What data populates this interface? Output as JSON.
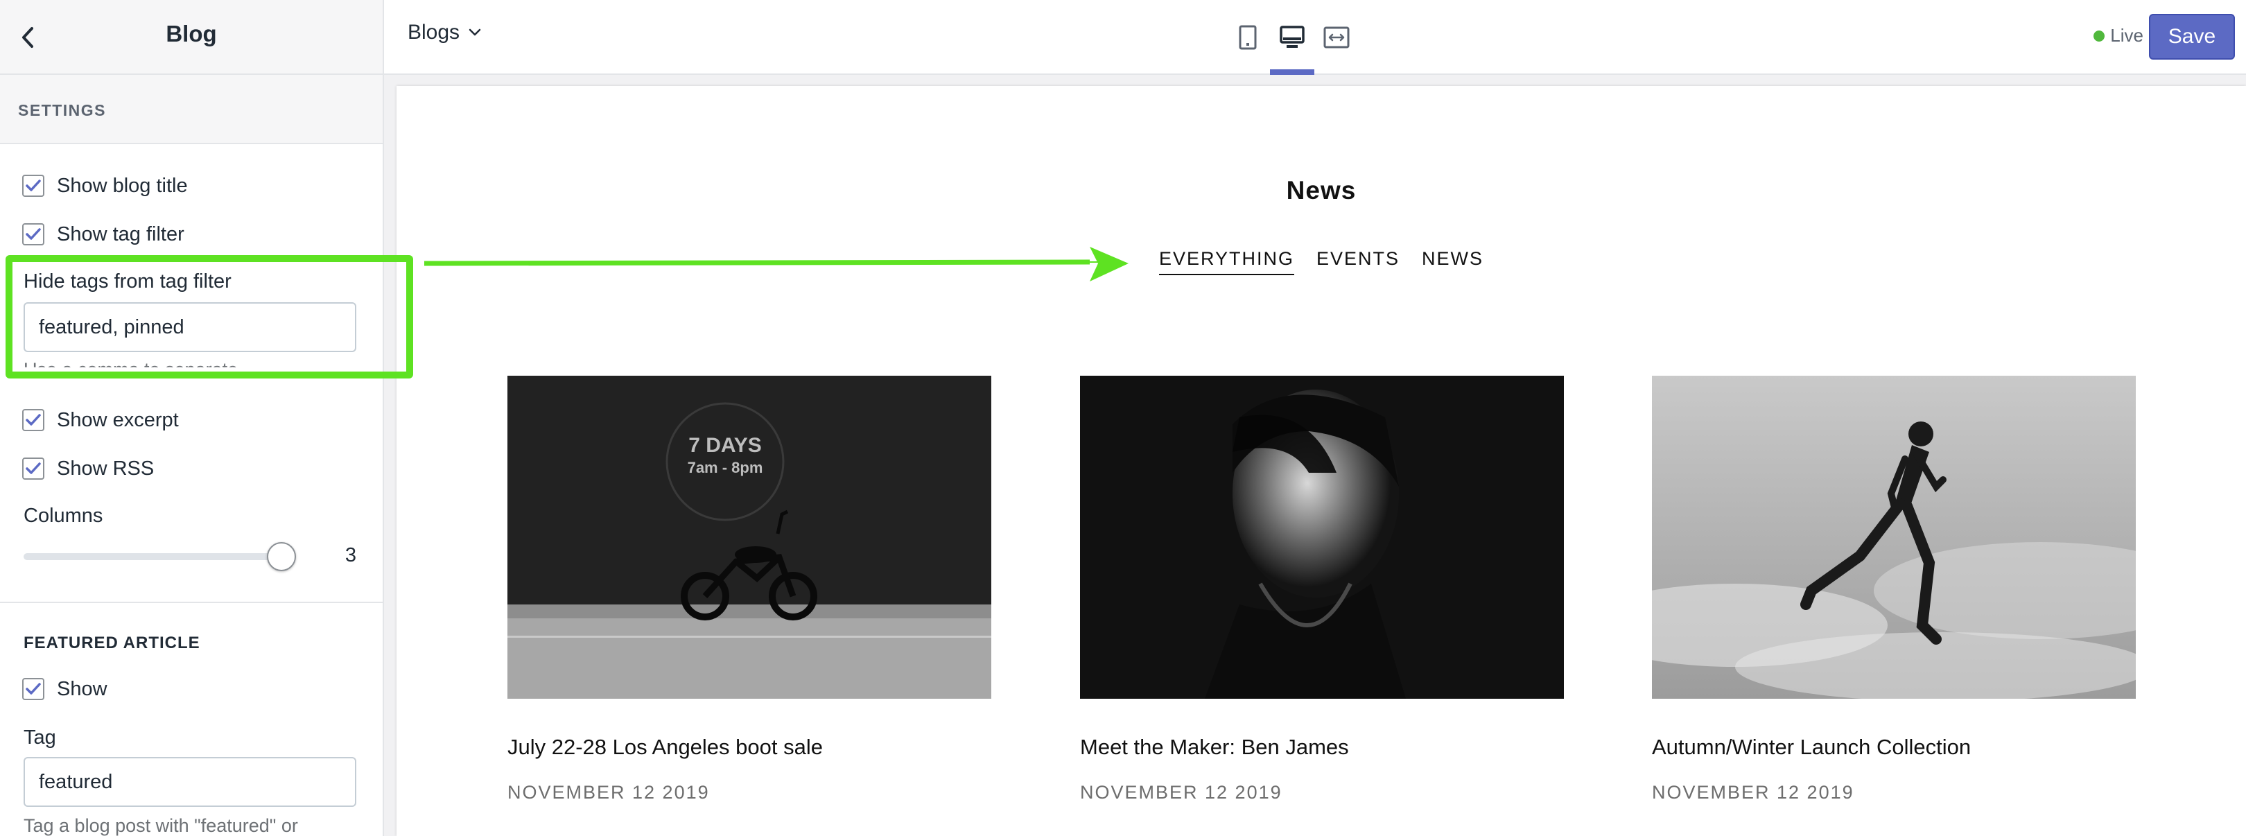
{
  "sidebar": {
    "back_icon": "chevron-left-icon",
    "title": "Blog",
    "section_label": "SETTINGS",
    "show_blog_title": {
      "label": "Show blog title",
      "checked": true
    },
    "show_tag_filter": {
      "label": "Show tag filter",
      "checked": true
    },
    "hide_tags": {
      "label": "Hide tags from tag filter",
      "value": "featured, pinned",
      "help": "Use a comma to separate"
    },
    "show_excerpt": {
      "label": "Show excerpt",
      "checked": true
    },
    "show_rss": {
      "label": "Show RSS",
      "checked": true
    },
    "columns": {
      "label": "Columns",
      "value": "3",
      "fraction": 1.0
    },
    "featured_article": {
      "heading": "FEATURED ARTICLE",
      "show": {
        "label": "Show",
        "checked": true
      },
      "tag_label": "Tag",
      "tag_value": "featured",
      "tag_help": "Tag a blog post with \"featured\" or"
    }
  },
  "topbar": {
    "blog_selector": "Blogs",
    "device_icons": [
      "mobile-icon",
      "desktop-icon",
      "fullwidth-icon"
    ],
    "active_device": "desktop-icon",
    "status": "Live",
    "status_color": "#50b83c",
    "save_label": "Save",
    "accent_color": "#5c6ac4"
  },
  "preview": {
    "blog_title": "News",
    "tags": [
      "EVERYTHING",
      "EVENTS",
      "NEWS"
    ],
    "active_tag": "EVERYTHING",
    "articles": [
      {
        "title": "July 22-28 Los Angeles boot sale",
        "date": "NOVEMBER 12 2019",
        "image_text_1": "7 DAYS",
        "image_text_2": "7am - 8pm"
      },
      {
        "title": "Meet the Maker: Ben James",
        "date": "NOVEMBER 12 2019"
      },
      {
        "title": "Autumn/Winter Launch Collection",
        "date": "NOVEMBER 12 2019"
      }
    ]
  },
  "annotation": {
    "highlight_color": "#5ee222"
  }
}
